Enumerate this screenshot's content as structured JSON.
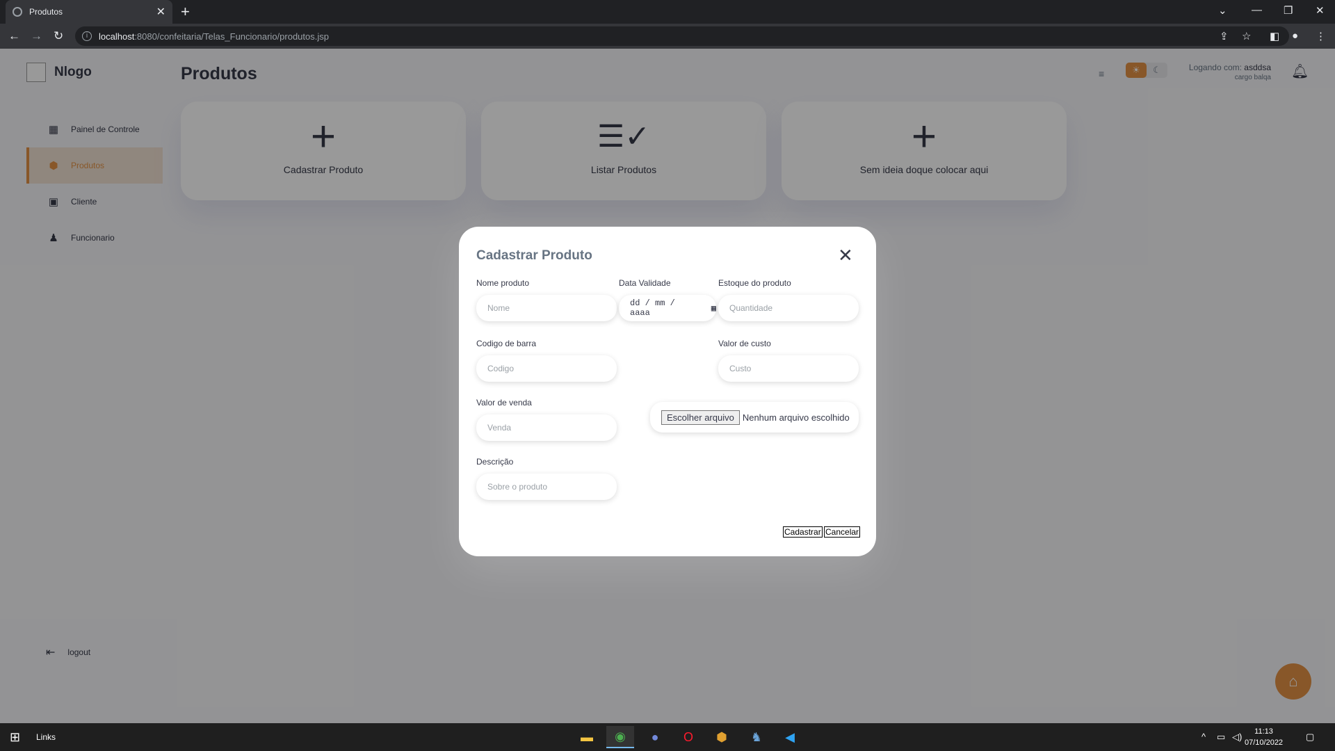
{
  "browser": {
    "tab_title": "Produtos",
    "url_host": "localhost",
    "url_rest": ":8080/confeitaria/Telas_Funcionario/produtos.jsp"
  },
  "header": {
    "logo_text": "Nlogo",
    "page_title": "Produtos",
    "user_line1_prefix": "Logando com: ",
    "user_name": "asddsa",
    "user_role": "cargo balqa"
  },
  "sidebar": {
    "items": [
      {
        "label": "Painel de Controle",
        "icon": "dashboard-icon"
      },
      {
        "label": "Produtos",
        "icon": "box-icon"
      },
      {
        "label": "Cliente",
        "icon": "contact-card-icon"
      },
      {
        "label": "Funcionario",
        "icon": "person-icon"
      }
    ],
    "logout_label": "logout"
  },
  "cards": [
    {
      "label": "Cadastrar Produto",
      "icon": "plus-icon"
    },
    {
      "label": "Listar Produtos",
      "icon": "checklist-icon"
    },
    {
      "label": "Sem ideia doque colocar aqui",
      "icon": "plus-icon"
    }
  ],
  "modal": {
    "title": "Cadastrar Produto",
    "fields": {
      "nome": {
        "label": "Nome produto",
        "placeholder": "Nome"
      },
      "data": {
        "label": "Data Validade",
        "value": "dd / mm / aaaa"
      },
      "estoque": {
        "label": "Estoque do produto",
        "placeholder": "Quantidade"
      },
      "codigo": {
        "label": "Codigo de barra",
        "placeholder": "Codigo"
      },
      "custo": {
        "label": "Valor de custo",
        "placeholder": "Custo"
      },
      "venda": {
        "label": "Valor de venda",
        "placeholder": "Venda"
      },
      "descricao": {
        "label": "Descrição",
        "placeholder": "Sobre o produto"
      }
    },
    "file_button": "Escolher arquivo",
    "file_status": "Nenhum arquivo escolhido",
    "submit_label": "Cadastrar",
    "cancel_label": "Cancelar"
  },
  "taskbar": {
    "links_label": "Links",
    "time": "11:13",
    "date": "07/10/2022"
  },
  "colors": {
    "accent": "#e39245",
    "text_dark": "#363949",
    "text_muted": "#677483"
  }
}
